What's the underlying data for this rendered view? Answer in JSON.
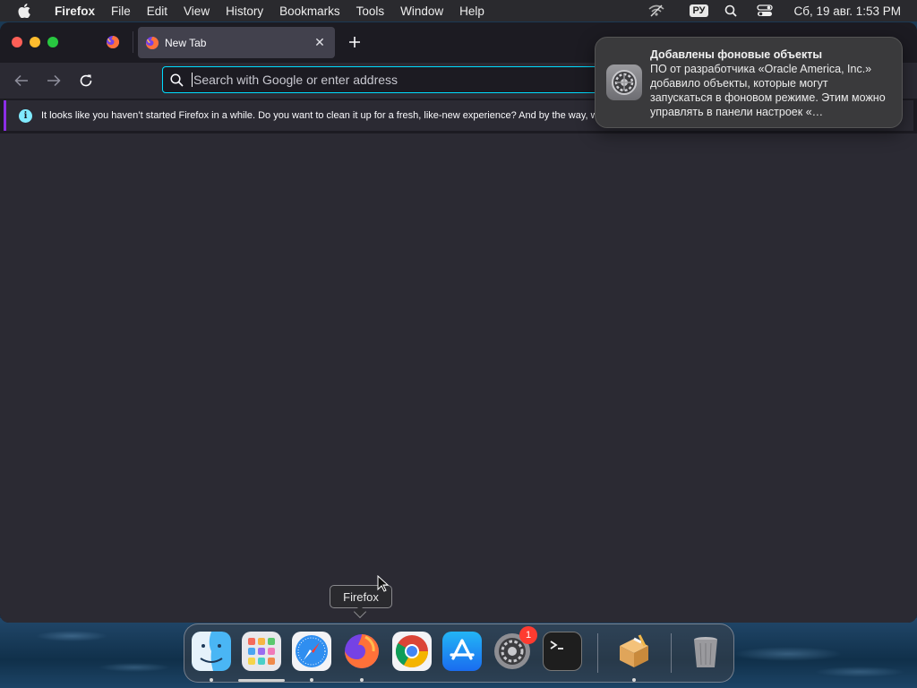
{
  "menubar": {
    "app_name": "Firefox",
    "items": [
      "File",
      "Edit",
      "View",
      "History",
      "Bookmarks",
      "Tools",
      "Window",
      "Help"
    ],
    "input_language": "РУ",
    "clock": "Сб, 19 авг.  1:53 PM",
    "icons": [
      "apple-logo-icon",
      "wifi-off-icon",
      "spotlight-search-icon",
      "control-center-icon"
    ]
  },
  "browser": {
    "tabs": [
      {
        "label": "New Tab",
        "active": true
      }
    ],
    "urlbar_placeholder": "Search with Google or enter address",
    "infobar_text": "It looks like you haven’t started Firefox in a while. Do you want to clean it up for a fresh, like-new experience? And by the way, welcome back!",
    "accent_color": "#00ddff",
    "infobar_accent": "#8c2ee6"
  },
  "notification": {
    "title": "Добавлены фоновые объекты",
    "body": "ПО от разработчика «Oracle America, Inc.» добавило объекты, которые могут запускаться в фоновом режиме. Этим можно управлять в панели настроек «…",
    "icon": "system-settings-icon"
  },
  "tooltip": {
    "label": "Firefox"
  },
  "dock": {
    "items": [
      {
        "name": "Finder",
        "icon": "finder-icon",
        "running": true
      },
      {
        "name": "Launchpad",
        "icon": "launchpad-icon",
        "running": false
      },
      {
        "name": "Safari",
        "icon": "safari-icon",
        "running": true
      },
      {
        "name": "Firefox",
        "icon": "firefox-icon",
        "running": true
      },
      {
        "name": "Google Chrome",
        "icon": "chrome-icon",
        "running": false
      },
      {
        "name": "App Store",
        "icon": "app-store-icon",
        "running": false
      },
      {
        "name": "System Settings",
        "icon": "system-settings-icon",
        "running": false,
        "badge": "1"
      },
      {
        "name": "Terminal",
        "icon": "terminal-icon",
        "running": false
      },
      {
        "name": "Installer",
        "icon": "installer-package-icon",
        "running": true
      },
      {
        "name": "Trash",
        "icon": "trash-icon",
        "running": false
      }
    ]
  }
}
